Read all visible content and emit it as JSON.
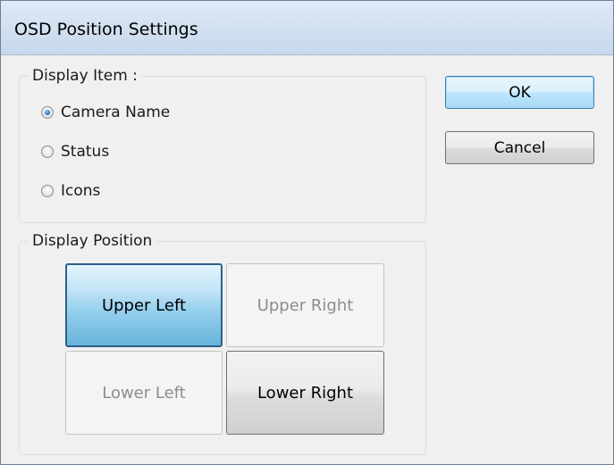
{
  "dialog": {
    "title": "OSD Position Settings"
  },
  "display_item": {
    "legend": "Display Item :",
    "options": [
      {
        "label": "Camera Name",
        "checked": true
      },
      {
        "label": "Status",
        "checked": false
      },
      {
        "label": "Icons",
        "checked": false
      }
    ]
  },
  "display_position": {
    "legend": "Display Position",
    "positions": {
      "upper_left": {
        "label": "Upper Left",
        "state": "selected"
      },
      "upper_right": {
        "label": "Upper Right",
        "state": "disabled"
      },
      "lower_left": {
        "label": "Lower Left",
        "state": "disabled"
      },
      "lower_right": {
        "label": "Lower Right",
        "state": "available"
      }
    }
  },
  "buttons": {
    "ok_label": "OK",
    "cancel_label": "Cancel"
  }
}
